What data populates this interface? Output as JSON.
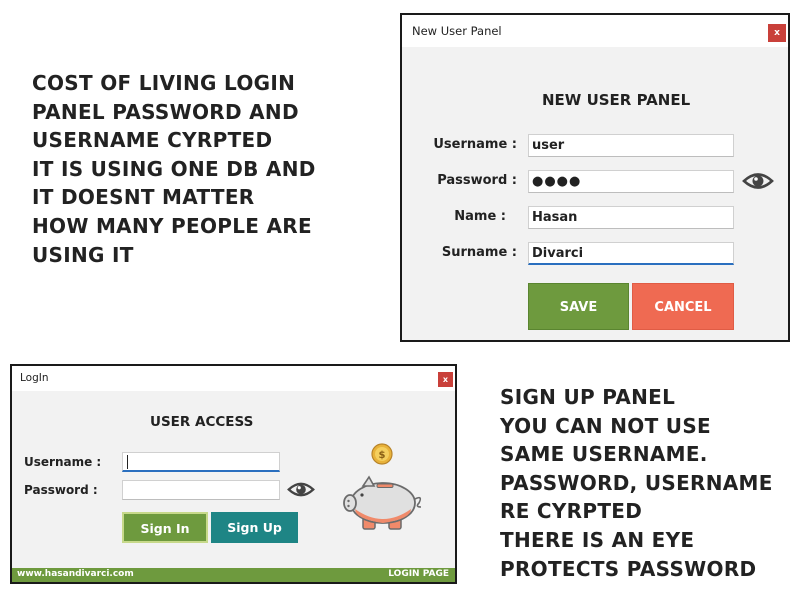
{
  "captions": {
    "left": "COST OF LIVING LOGIN\nPANEL PASSWORD AND\nUSERNAME CYRPTED\nIT IS USING ONE DB AND\nIT DOESNT MATTER\nHOW MANY PEOPLE ARE\nUSING IT",
    "right": "SIGN UP PANEL\nYOU CAN NOT USE\nSAME USERNAME.\nPASSWORD, USERNAME\nRE CYRPTED\nTHERE IS AN EYE\nPROTECTS PASSWORD"
  },
  "new_user_window": {
    "title": "New User Panel",
    "close_label": "x",
    "heading": "NEW USER PANEL",
    "fields": {
      "username": {
        "label": "Username :",
        "value": "user"
      },
      "password": {
        "label": "Password :",
        "value": "●●●●"
      },
      "name": {
        "label": "Name :",
        "value": "Hasan"
      },
      "surname": {
        "label": "Surname :",
        "value": "Divarci"
      }
    },
    "save_label": "SAVE",
    "cancel_label": "CANCEL",
    "eye_icon": "eye-icon"
  },
  "login_window": {
    "title": "LogIn",
    "close_label": "x",
    "heading": "USER ACCESS",
    "username_label": "Username :",
    "password_label": "Password :",
    "username_value": "",
    "password_value": "",
    "signin_label": "Sign In",
    "signup_label": "Sign Up",
    "coin_symbol": "$",
    "footer": {
      "url": "www.hasandivarci.com",
      "page": "LOGIN PAGE"
    }
  },
  "colors": {
    "green": "#6e9a3e",
    "red": "#ef6a52",
    "teal": "#1e8585",
    "close": "#c9403a"
  }
}
